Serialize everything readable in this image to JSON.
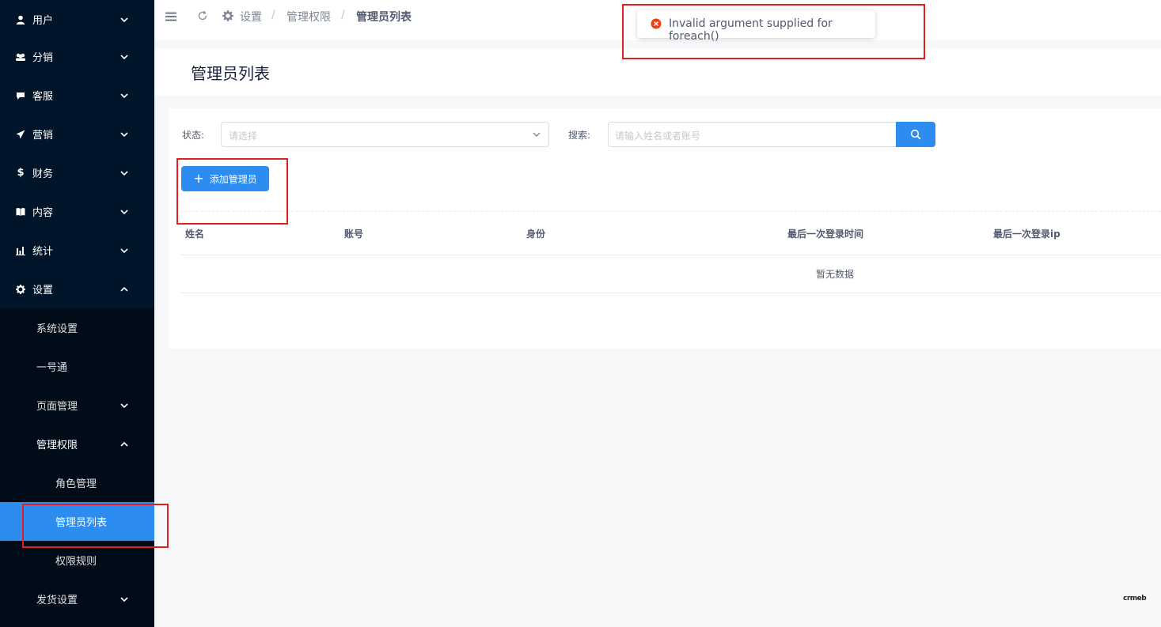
{
  "sidebar": {
    "menus": [
      {
        "label": "用户",
        "icon": "user-icon"
      },
      {
        "label": "分销",
        "icon": "users-icon"
      },
      {
        "label": "客服",
        "icon": "chat-icon"
      },
      {
        "label": "营销",
        "icon": "send-icon"
      },
      {
        "label": "财务",
        "icon": "dollar-icon"
      },
      {
        "label": "内容",
        "icon": "book-icon"
      },
      {
        "label": "统计",
        "icon": "bar-chart-icon"
      },
      {
        "label": "设置",
        "icon": "gear-icon"
      }
    ],
    "submenus": [
      {
        "label": "系统设置"
      },
      {
        "label": "一号通"
      },
      {
        "label": "页面管理"
      },
      {
        "label": "管理权限"
      },
      {
        "label": "角色管理"
      },
      {
        "label": "管理员列表"
      },
      {
        "label": "权限规则"
      },
      {
        "label": "发货设置"
      }
    ]
  },
  "header": {
    "breadcrumb": [
      "设置",
      "管理权限",
      "管理员列表"
    ],
    "separator": "/"
  },
  "toast": {
    "message": "Invalid argument supplied for foreach()"
  },
  "page": {
    "title": "管理员列表"
  },
  "filters": {
    "status_label": "状态:",
    "status_placeholder": "请选择",
    "search_label": "搜索:",
    "search_placeholder": "请输入姓名或者账号"
  },
  "actions": {
    "add_label": "添加管理员"
  },
  "table": {
    "columns": [
      "姓名",
      "账号",
      "身份",
      "最后一次登录时间",
      "最后一次登录ip"
    ],
    "empty_text": "暂无数据"
  },
  "footer": {
    "logo_text": "crmeb"
  },
  "colors": {
    "primary": "#2d8cf0",
    "sidebar_bg": "#001529",
    "error": "#ed4014",
    "annotation": "#e02020"
  }
}
